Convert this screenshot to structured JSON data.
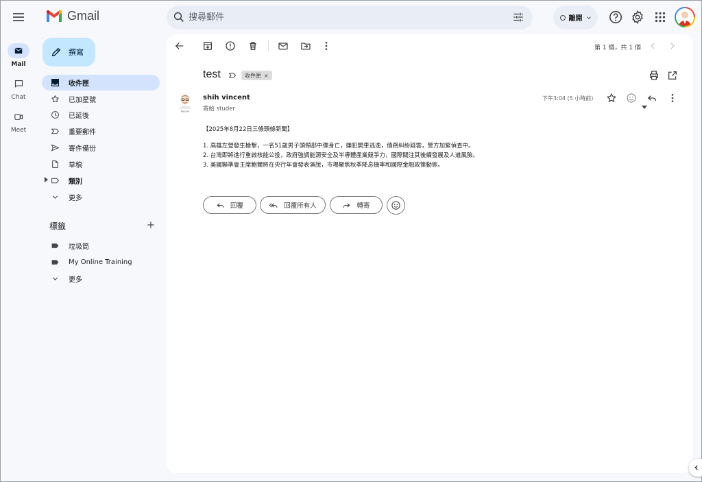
{
  "app": {
    "name": "Gmail"
  },
  "search": {
    "placeholder": "搜尋郵件"
  },
  "status": {
    "label": "離開"
  },
  "rail": [
    {
      "label": "Mail"
    },
    {
      "label": "Chat"
    },
    {
      "label": "Meet"
    }
  ],
  "compose": {
    "label": "撰寫"
  },
  "nav": [
    {
      "label": "收件匣"
    },
    {
      "label": "已加星號"
    },
    {
      "label": "已延後"
    },
    {
      "label": "重要郵件"
    },
    {
      "label": "寄件備份"
    },
    {
      "label": "草稿"
    },
    {
      "label": "類別"
    },
    {
      "label": "更多"
    }
  ],
  "labels": {
    "title": "標籤",
    "items": [
      {
        "label": "垃圾筒"
      },
      {
        "label": "My Online Training"
      },
      {
        "label": "更多"
      }
    ]
  },
  "toolbar": {
    "pager": "第 1 個，共 1 個"
  },
  "message": {
    "subject": "test",
    "label_chip": "收件匣",
    "sender": "shih vincent",
    "recipient": "寄給 studer",
    "time": "下午3:04 (5 小時前)",
    "body": [
      "【2025年8月22日三條頭條新聞】",
      "1. 高雄左營發生槍擊，一名51歲男子頭頸部中彈身亡，嫌犯開車逃逸，債務糾紛疑雲，警方加緊偵查中。",
      "2. 台灣即將進行重啟核能公投，政府強調能源安全及半導體產業競爭力，國際關注其後續發展及人道風險。",
      "3. 美國聯準會主席鮑爾將在央行年會發表演說，市場聚焦秋季降息機率和國際金融政策動態。"
    ]
  },
  "actions": {
    "reply": "回覆",
    "reply_all": "回覆所有人",
    "forward": "轉寄"
  },
  "colors": {
    "accent": "#0b57d0",
    "active_nav": "#d3e3fd",
    "compose": "#c2e7ff"
  }
}
